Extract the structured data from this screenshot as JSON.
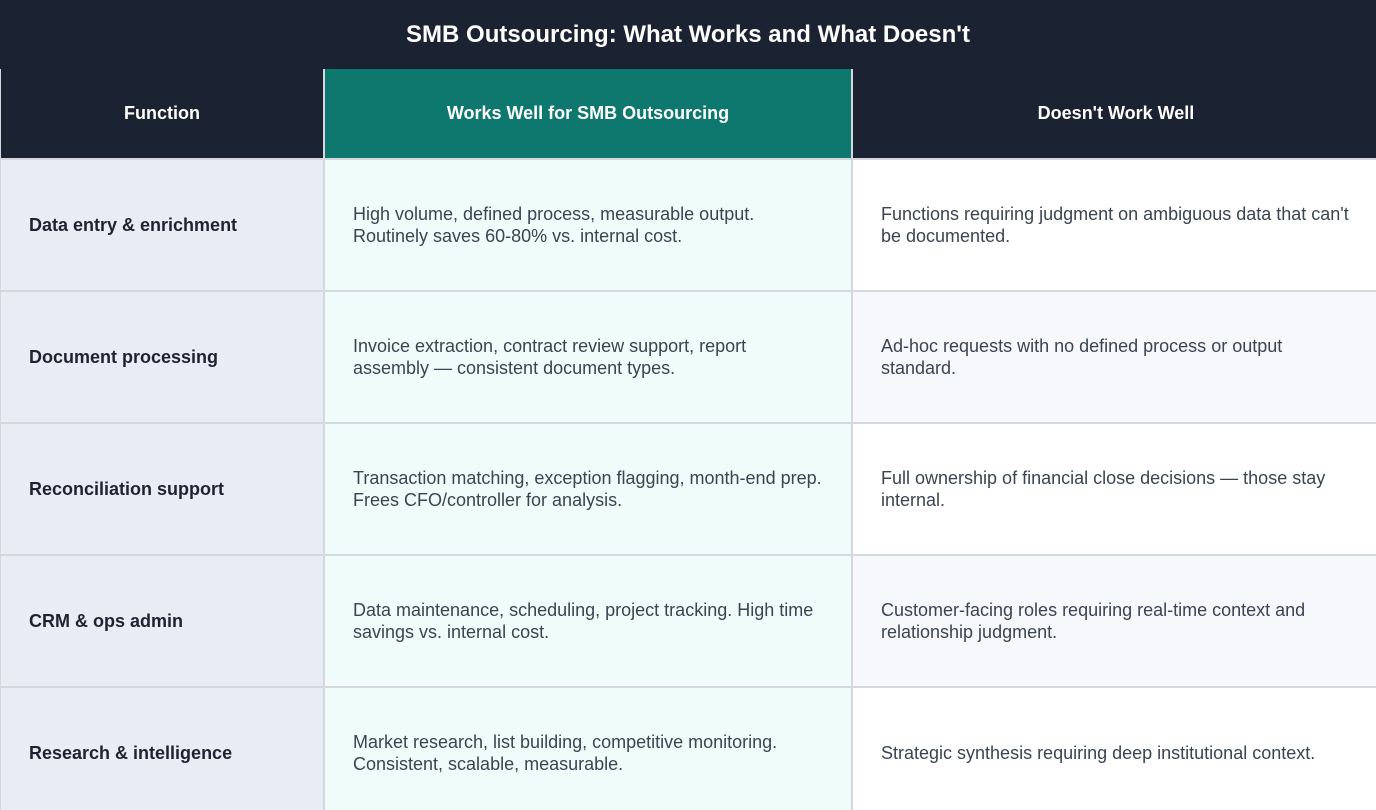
{
  "title": "SMB Outsourcing: What Works and What Doesn't",
  "colors": {
    "header_dark": "#1b2333",
    "header_accent": "#0e776e",
    "function_cell_bg": "#e8ecf4",
    "works_cell_bg": "#effcfa"
  },
  "table": {
    "headers": [
      "Function",
      "Works Well for SMB Outsourcing",
      "Doesn't Work Well"
    ],
    "rows": [
      {
        "function": "Data entry & enrichment",
        "works": "High volume, defined process, measurable output. Routinely saves 60-80% vs. internal cost.",
        "doesnt": "Functions requiring judgment on ambiguous data that can't be documented."
      },
      {
        "function": "Document processing",
        "works": "Invoice extraction, contract review support, report assembly — consistent document types.",
        "doesnt": "Ad-hoc requests with no defined process or output standard."
      },
      {
        "function": "Reconciliation support",
        "works": "Transaction matching, exception flagging, month-end prep. Frees CFO/controller for analysis.",
        "doesnt": "Full ownership of financial close decisions — those stay internal."
      },
      {
        "function": "CRM & ops admin",
        "works": "Data maintenance, scheduling, project tracking. High time savings vs. internal cost.",
        "doesnt": "Customer-facing roles requiring real-time context and relationship judgment."
      },
      {
        "function": "Research & intelligence",
        "works": "Market research, list building, competitive monitoring. Consistent, scalable, measurable.",
        "doesnt": "Strategic synthesis requiring deep institutional context."
      }
    ]
  }
}
